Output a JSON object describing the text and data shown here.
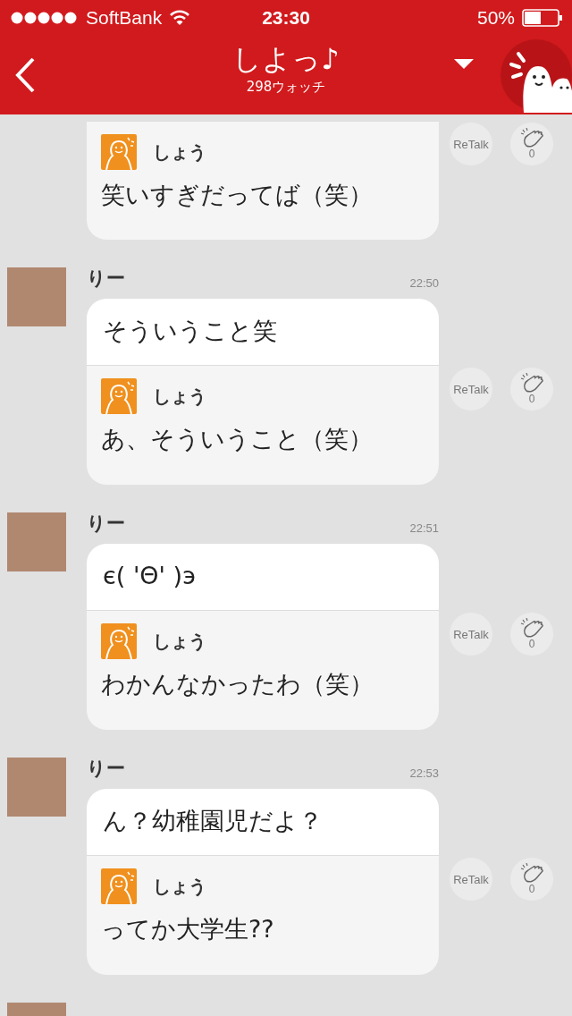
{
  "status_bar": {
    "carrier": "SoftBank",
    "time": "23:30",
    "battery": "50%"
  },
  "header": {
    "title": "しよっ♪",
    "subtitle": "298ウォッチ"
  },
  "messages": [
    {
      "reply": {
        "name": "しょう",
        "text": "笑いすぎだってば（笑）"
      },
      "retalk": "ReTalk",
      "claps": "0"
    },
    {
      "name": "りー",
      "time": "22:50",
      "text": "そういうこと笑",
      "reply": {
        "name": "しょう",
        "text": "あ、そういうこと（笑）"
      },
      "retalk": "ReTalk",
      "claps": "0"
    },
    {
      "name": "りー",
      "time": "22:51",
      "text": "є( 'Θ' )э",
      "reply": {
        "name": "しょう",
        "text": "わかんなかったわ（笑）"
      },
      "retalk": "ReTalk",
      "claps": "0"
    },
    {
      "name": "りー",
      "time": "22:53",
      "text": "ん？幼稚園児だよ？",
      "reply": {
        "name": "しょう",
        "text": "ってか大学生??"
      },
      "retalk": "ReTalk",
      "claps": "0"
    }
  ]
}
